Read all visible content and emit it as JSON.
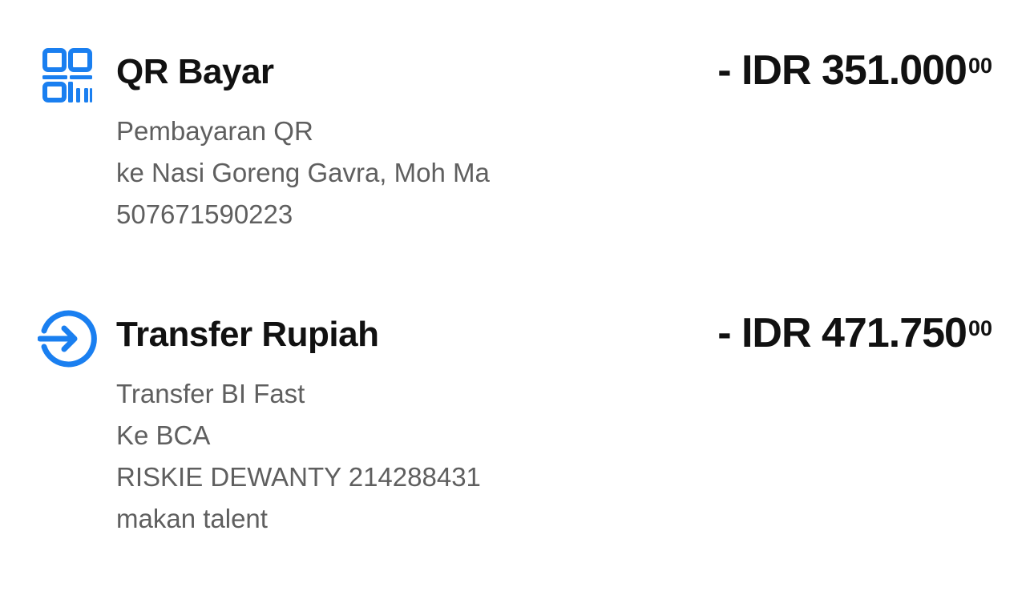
{
  "colors": {
    "accent": "#1a7ff0",
    "title_text": "#111111",
    "detail_text": "#5f5f5f"
  },
  "transactions": [
    {
      "icon": "qr-code-icon",
      "title": "QR Bayar",
      "amount_main": "- IDR 351.000",
      "amount_cents": "00",
      "details": [
        "Pembayaran QR",
        "ke Nasi Goreng Gavra, Moh Ma",
        "507671590223"
      ]
    },
    {
      "icon": "transfer-arrow-icon",
      "title": "Transfer Rupiah",
      "amount_main": "- IDR 471.750",
      "amount_cents": "00",
      "details": [
        "Transfer BI Fast",
        "Ke BCA",
        "RISKIE DEWANTY 214288431",
        "makan talent"
      ]
    }
  ]
}
